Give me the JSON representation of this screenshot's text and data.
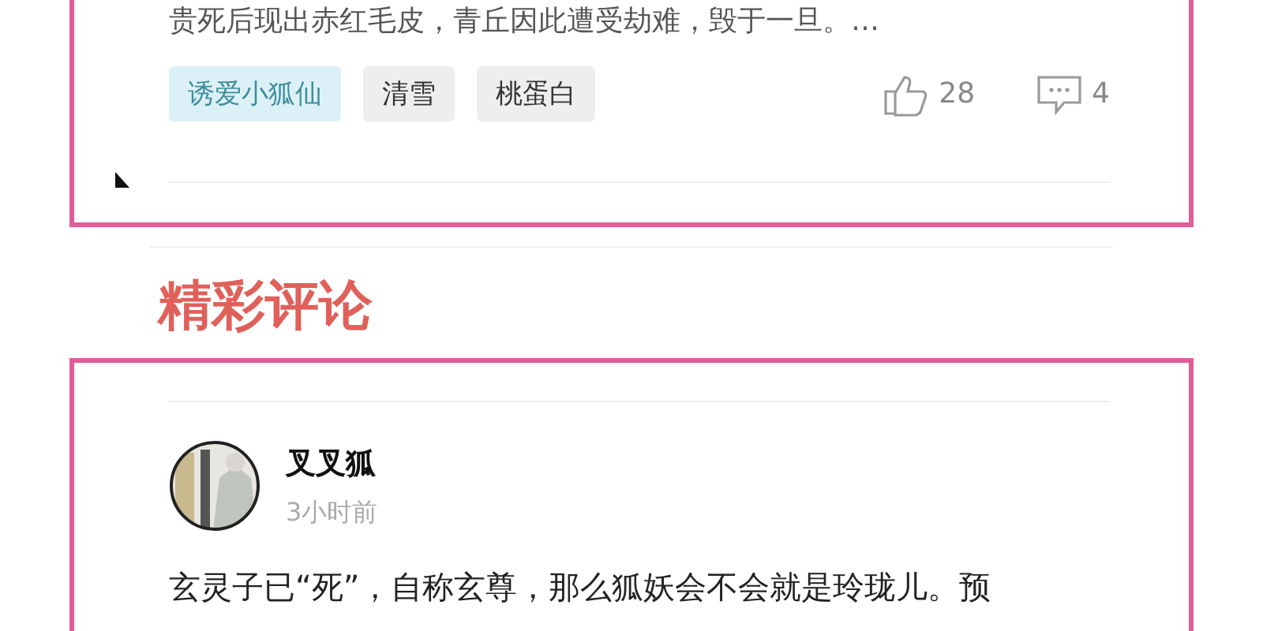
{
  "post": {
    "excerpt_tail": "贵死后现出赤红毛皮，青丘因此遭受劫难，毁于一旦。…",
    "tags": [
      {
        "label": "诱爱小狐仙",
        "kind": "topic"
      },
      {
        "label": "清雪",
        "kind": "plain"
      },
      {
        "label": "桃蛋白",
        "kind": "plain"
      }
    ],
    "likes": "28",
    "comments": "4"
  },
  "section_title": "精彩评论",
  "comment": {
    "author": "叉叉狐",
    "time": "3小时前",
    "text": "玄灵子已“死”，自称玄尊，那么狐妖会不会就是玲珑儿。预"
  }
}
